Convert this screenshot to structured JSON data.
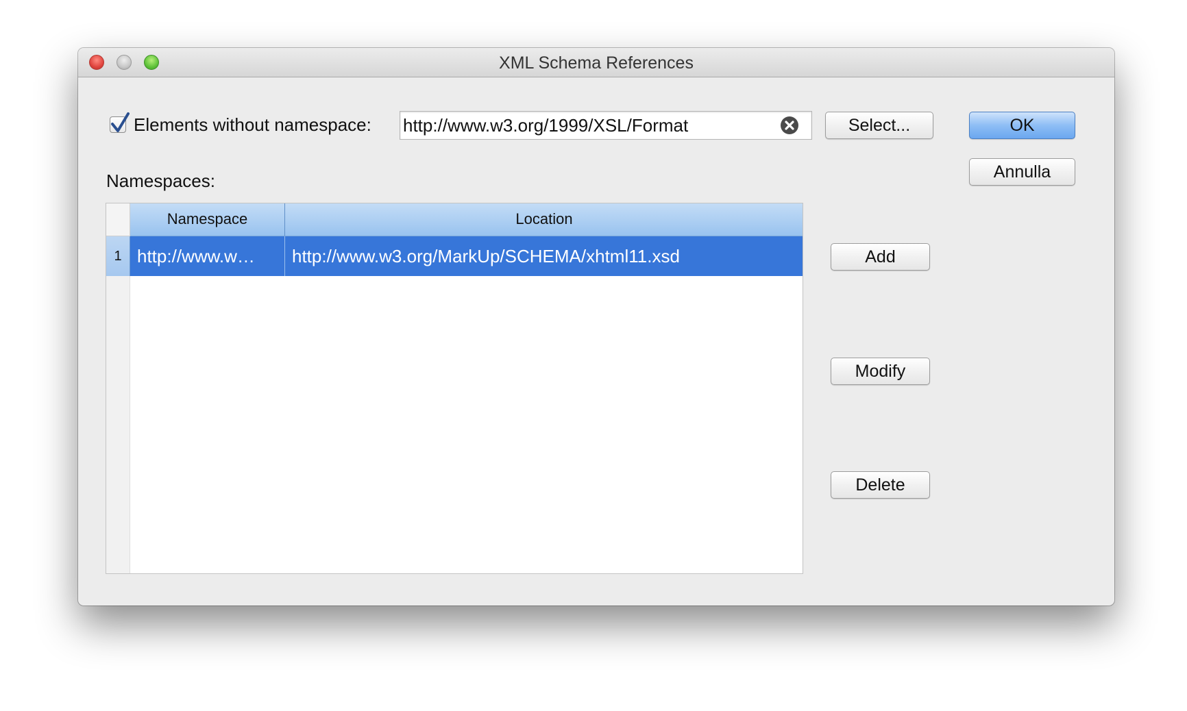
{
  "window": {
    "title": "XML Schema References"
  },
  "no_namespace": {
    "checked": true,
    "label": "Elements without namespace:",
    "value": "http://www.w3.org/1999/XSL/Format",
    "select_label": "Select..."
  },
  "namespaces": {
    "label": "Namespaces:",
    "columns": [
      "Namespace",
      "Location"
    ],
    "rows": [
      {
        "index": "1",
        "namespace": "http://www.w…",
        "location": "http://www.w3.org/MarkUp/SCHEMA/xhtml11.xsd",
        "selected": true
      }
    ]
  },
  "buttons": {
    "ok": "OK",
    "cancel": "Annulla",
    "add": "Add",
    "modify": "Modify",
    "delete": "Delete"
  },
  "colors": {
    "selection": "#3776d9",
    "header": "#a9cdf3",
    "default_button": "#8ebef5"
  }
}
